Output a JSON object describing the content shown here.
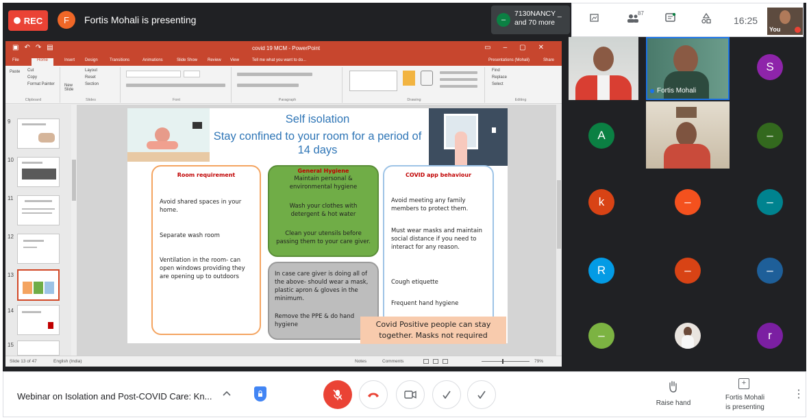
{
  "topbar": {
    "rec_label": "REC",
    "presenter_initial": "F",
    "presenter_text": "Fortis Mohali is presenting",
    "participant_icon_text": "–",
    "participant_name": "7130NANCY _",
    "participant_more": "and 70 more",
    "people_count": "87",
    "time": "16:25",
    "you_label": "You"
  },
  "ppt": {
    "window_title": "covid 19 MCM - PowerPoint",
    "tabs": [
      "File",
      "Home",
      "Insert",
      "Design",
      "Transitions",
      "Animations",
      "Slide Show",
      "Review",
      "View"
    ],
    "tell_me": "Tell me what you want to do...",
    "presenter_tag": "Presentations (Mohali)",
    "share_label": "Share",
    "ribbon_groups": [
      "Clipboard",
      "Slides",
      "Font",
      "Paragraph",
      "Drawing",
      "Editing"
    ],
    "ribbon_items": {
      "cut": "Cut",
      "copy": "Copy",
      "format_painter": "Format Painter",
      "paste": "Paste",
      "new_slide": "New Slide",
      "layout": "Layout",
      "reset": "Reset",
      "section": "Section",
      "find": "Find",
      "replace": "Replace",
      "select": "Select"
    },
    "thumb_numbers": [
      "9",
      "10",
      "11",
      "12",
      "13",
      "14",
      "15"
    ],
    "status_slide": "Slide 13 of 47",
    "status_lang": "English (India)",
    "status_notes": "Notes",
    "status_comments": "Comments",
    "status_zoom": "79%"
  },
  "slide": {
    "title": "Self isolation",
    "subtitle": "Stay confined to your room for a period of 14 days",
    "room": {
      "heading": "Room requirement",
      "p1": "Avoid shared spaces in your home.",
      "p2": "Separate wash room",
      "p3": "Ventilation in the room- can open windows providing they are opening up to outdoors"
    },
    "hygiene": {
      "heading": "General Hygiene",
      "p1": "Maintain personal & environmental hygiene",
      "p2": "Wash your clothes with detergent & hot water",
      "p3": "Clean your utensils before passing them to your care giver."
    },
    "care": {
      "p1": "In case care giver is doing all of the above- should wear a mask, plastic apron & gloves in the minimum.",
      "p2": "Remove the PPE & do hand hygiene"
    },
    "app": {
      "heading": "COVID app behaviour",
      "p1": "Avoid meeting any family members to protect them.",
      "p2": "Must wear masks and maintain social distance if you need to interact for any reason.",
      "p3": "Cough etiquette",
      "p4": "Frequent hand hygiene"
    },
    "banner": "Covid Positive people can stay together. Masks not required"
  },
  "participants": [
    {
      "type": "avatar",
      "letter": "S",
      "color": "#8e24aa"
    },
    {
      "type": "avatar",
      "letter": "A",
      "color": "#0b8043"
    },
    {
      "type": "avatar",
      "letter": "–",
      "color": "#33691e"
    },
    {
      "type": "avatar",
      "letter": "k",
      "color": "#d84315"
    },
    {
      "type": "avatar",
      "letter": "–",
      "color": "#f4511e"
    },
    {
      "type": "avatar",
      "letter": "–",
      "color": "#00838f"
    },
    {
      "type": "avatar",
      "letter": "R",
      "color": "#039be5"
    },
    {
      "type": "avatar",
      "letter": "–",
      "color": "#d84315"
    },
    {
      "type": "avatar",
      "letter": "–",
      "color": "#1e5f99"
    },
    {
      "type": "avatar",
      "letter": "–",
      "color": "#7cb342"
    },
    {
      "type": "avatar",
      "letter": "r",
      "color": "#7b1fa2"
    }
  ],
  "videos": {
    "fortis_label": "Fortis Mohali"
  },
  "bottombar": {
    "meeting_title": "Webinar on Isolation and Post-COVID Care: Kn...",
    "raise_hand": "Raise hand",
    "presenting_line1": "Fortis Mohali",
    "presenting_line2": "is presenting"
  }
}
